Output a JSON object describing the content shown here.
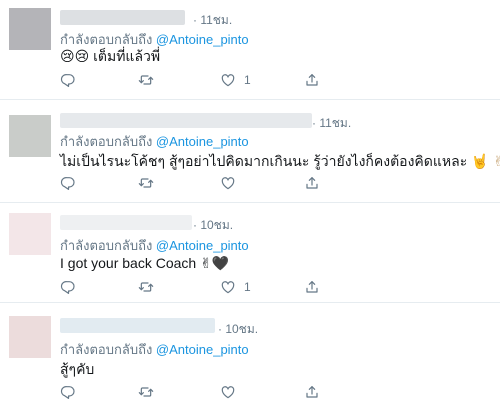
{
  "theme": {
    "muted": "#657786",
    "link": "#1b95e0",
    "border": "#e6ecf0"
  },
  "icons": [
    "reply-icon",
    "retweet-icon",
    "like-icon",
    "share-icon"
  ],
  "tweets": [
    {
      "time": "· 11ชม.",
      "reply_prefix": "กำลังตอบกลับถึง",
      "mention": "@Antoine_pinto",
      "text": "เต็มที่แล้วพี่",
      "emoji": "😢😢",
      "emoji_pos": "before",
      "likes": "1",
      "avatar_color": "#b4b4b8",
      "name_color": "#dde0e3"
    },
    {
      "time": "· 11ชม.",
      "reply_prefix": "กำลังตอบกลับถึง",
      "mention": "@Antoine_pinto",
      "text": "ไม่เป็นไรนะโค้ชๆ สู้ๆอย่าไปคิดมากเกินนะ รู้ว่ายังไงก็คงต้องคิดแหละ",
      "emoji": "🤘 ✌",
      "emoji_pos": "after",
      "likes": "",
      "avatar_color": "#c9ccc9",
      "name_color": "#e6e9ec"
    },
    {
      "time": "· 10ชม.",
      "reply_prefix": "กำลังตอบกลับถึง",
      "mention": "@Antoine_pinto",
      "text": "I got your back Coach",
      "emoji": "✌🖤",
      "emoji_pos": "after",
      "likes": "1",
      "avatar_color": "#f3e6e8",
      "name_color": "#eef0f2"
    },
    {
      "time": "· 10ชม.",
      "reply_prefix": "กำลังตอบกลับถึง",
      "mention": "@Antoine_pinto",
      "text": "สู้ๆคับ",
      "emoji": "",
      "emoji_pos": "after",
      "likes": "",
      "avatar_color": "#ecdcdc",
      "name_color": "#e2ebf1"
    }
  ]
}
